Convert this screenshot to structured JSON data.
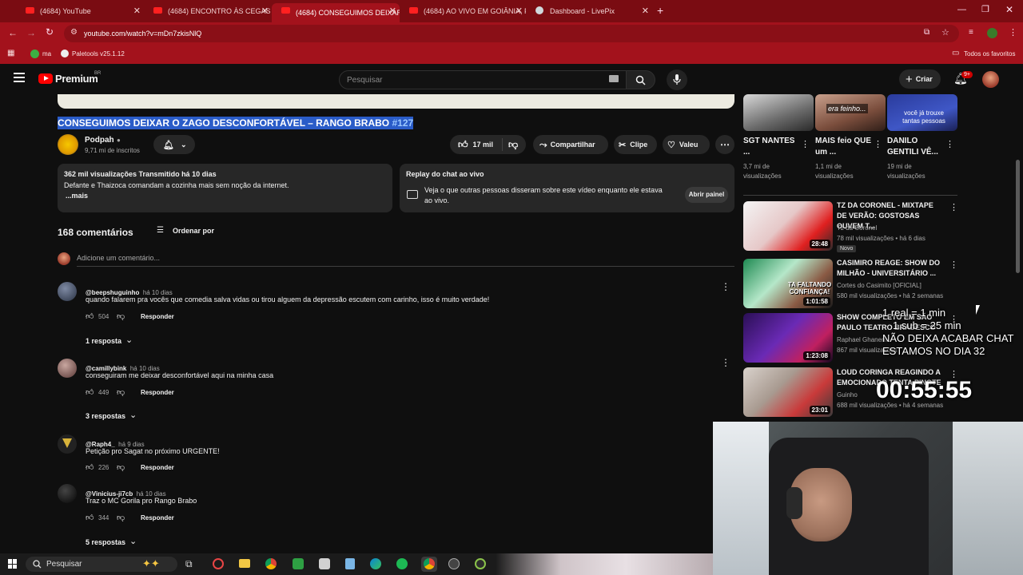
{
  "browser": {
    "tabs": [
      {
        "label": "(4684) YouTube"
      },
      {
        "label": "(4684) ENCONTRO ÀS CEGAS C"
      },
      {
        "label": "(4684) CONSEGUIMOS DEIXAR"
      },
      {
        "label": "(4684) AO VIVO EM GOIÂNIA, P"
      },
      {
        "label": "Dashboard - LivePix"
      }
    ],
    "url": "youtube.com/watch?v=mDn7zkisNlQ",
    "bookmarks": [
      {
        "label": "ma"
      },
      {
        "label": "Paletools v25.1.12"
      }
    ],
    "all_bookmarks": "Todos os favoritos"
  },
  "header": {
    "logo": "Premium",
    "country": "BR",
    "search_placeholder": "Pesquisar",
    "create_label": "Criar",
    "notif_count": "9+"
  },
  "video": {
    "title": "CONSEGUIMOS DEIXAR O ZAGO DESCONFORTÁVEL – RANGO BRABO",
    "hashtag": "#127",
    "channel": "Podpah",
    "subscribers": "9,71 mi de inscritos",
    "likes": "17 mil",
    "share": "Compartilhar",
    "clip": "Clipe",
    "thanks": "Valeu",
    "stats": "362 mil visualizações  Transmitido há 10 dias",
    "description": "Defante e Thaizoca comandam a cozinha mais sem noção da internet.",
    "more": "...mais",
    "chat_title": "Replay do chat ao vivo",
    "chat_desc_1": "Veja o que outras pessoas disseram sobre este vídeo enquanto ele estava",
    "chat_desc_2": "ao vivo.",
    "open_panel": "Abrir painel"
  },
  "comments": {
    "count_label": "168 comentários",
    "sort_label": "Ordenar por",
    "add_placeholder": "Adicione um comentário...",
    "reply_label": "Responder",
    "items": [
      {
        "user": "@beepshuguinho",
        "time": "há 10 dias",
        "text": "quando falarem pra vocês que comedia salva vidas ou tirou alguem da depressão escutem com carinho, isso é muito verdade!",
        "likes": "504",
        "replies": "1 resposta"
      },
      {
        "user": "@camillybink",
        "time": "há 10 dias",
        "text": "conseguiram me deixar desconfortável aqui na minha casa",
        "likes": "449",
        "replies": "3 respostas"
      },
      {
        "user": "@Raph4_",
        "time": "há 9 dias",
        "text": "Petição pro Sagat no próximo URGENTE!",
        "likes": "226",
        "replies": ""
      },
      {
        "user": "@Vinicius-ji7cb",
        "time": "há 10 dias",
        "text": "Traz o MC Gorila pro Rango Brabo",
        "likes": "344",
        "replies": "5 respostas"
      }
    ]
  },
  "shorts": [
    {
      "title": "SGT NANTES ...",
      "views": "3,7 mi de visualizações",
      "overlay": ""
    },
    {
      "title": "MAIS feio QUE um ...",
      "views": "1,1 mi de visualizações",
      "overlay": "era feinho..."
    },
    {
      "title": "DANILO GENTILI VÊ...",
      "views": "19 mi de visualizações",
      "overlay": "você já trouxe tantas pessoas"
    }
  ],
  "recommendations": [
    {
      "title": "TZ DA CORONEL - MIXTAPE DE VERÃO: GOSTOSAS OUVEM T...",
      "channel": "Tz da Coronel",
      "meta": "78 mil visualizações • há 6 dias",
      "badge": "Novo",
      "duration": "28:48",
      "thumb_text": ""
    },
    {
      "title": "CASIMIRO REAGE: SHOW DO MILHÃO - UNIVERSITÁRIO ...",
      "channel": "Cortes do Casimito [OFICIAL]",
      "meta": "580 mil visualizações • há 2 semanas",
      "badge": "",
      "duration": "1:01:58",
      "thumb_text": "TA FALTANDO CONFIANÇA!"
    },
    {
      "title": "SHOW COMPLETO EM SÃO PAULO TEATRO BRADESCO",
      "channel": "Raphael Ghanem",
      "meta": "867 mil visualizações",
      "badge": "",
      "duration": "1:23:08",
      "thumb_text": ""
    },
    {
      "title": "LOUD CORINGA REAGINDO A EMOCIONADO TENTA PINOTE",
      "channel": "Guinho",
      "meta": "688 mil visualizações • há 4 semanas",
      "badge": "",
      "duration": "23:01",
      "thumb_text": ""
    }
  ],
  "stream_overlay": {
    "line1": "1 real = 1 min",
    "line2": "1 sub = 25 min",
    "line3": "NÃO DEIXA ACABAR CHAT",
    "line4": "ESTAMOS NO DIA 32",
    "timer": "00:55:55"
  },
  "taskbar": {
    "search_label": "Pesquisar"
  },
  "colors": {
    "chrome_red": "#a3121c",
    "youtube_red": "#ff0000",
    "link_blue": "#3ea6ff",
    "title_highlight": "#2a5cc8"
  }
}
